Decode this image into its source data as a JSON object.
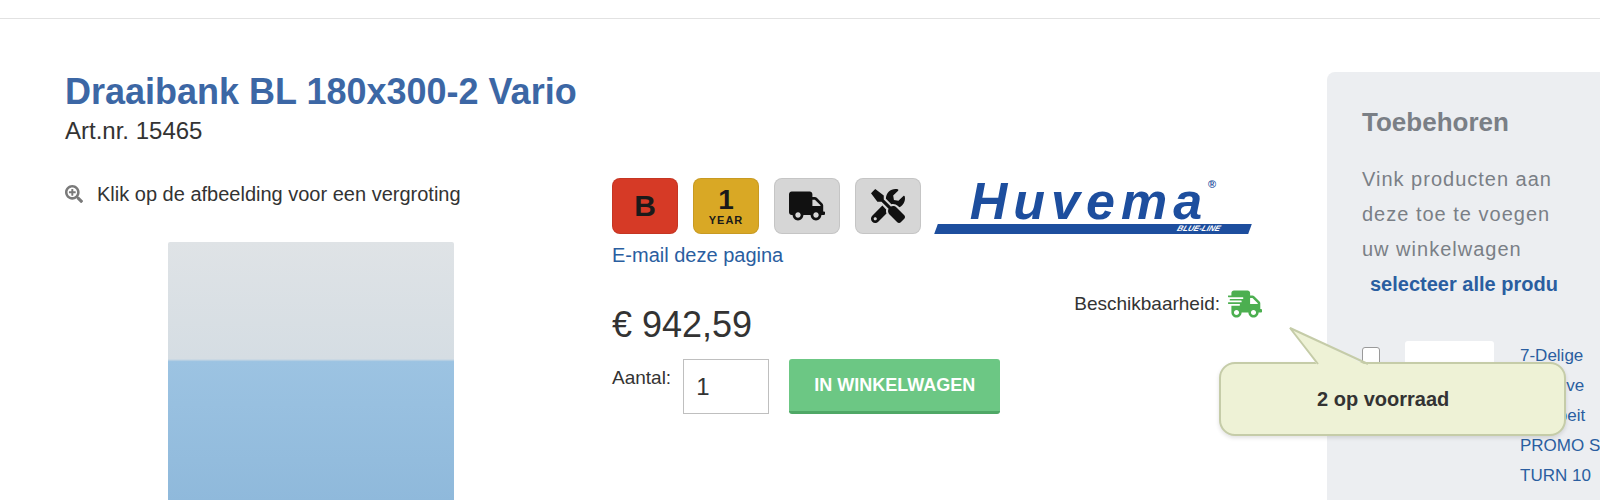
{
  "page": {
    "title": "Draaibank BL 180x300-2 Vario",
    "article_number": "Art.nr. 15465",
    "zoom_hint": "Klik op de afbeelding voor een vergroting"
  },
  "badges": [
    {
      "kind": "letter",
      "text": "B",
      "color": "#d63a26"
    },
    {
      "kind": "year",
      "text": "1",
      "sub": "YEAR",
      "color": "#d9a825"
    },
    {
      "kind": "truck",
      "color": "#d6d6d6"
    },
    {
      "kind": "tools",
      "color": "#d6d6d6"
    }
  ],
  "brand": {
    "name": "Huvema",
    "registered": "®",
    "line": "BLUE-LINE"
  },
  "email_link": "E-mail deze pagina",
  "price": "€ 942,59",
  "availability": {
    "label": "Beschikbaarheid:",
    "in_stock": true,
    "tooltip": "2 op voorraad"
  },
  "quantity": {
    "label": "Aantal:",
    "value": "1"
  },
  "cart_button": "IN WINKELWAGEN",
  "accessories": {
    "title": "Toebehoren",
    "intro": [
      "Vink producten aan",
      "deze toe te voegen",
      "uw winkelwagen"
    ],
    "select_all": "selecteer alle produ",
    "items": [
      {
        "checked": false,
        "lines": [
          "7-Delige",
          "met dive",
          "draaibeit",
          "PROMO S",
          "TURN 10"
        ]
      }
    ]
  }
}
